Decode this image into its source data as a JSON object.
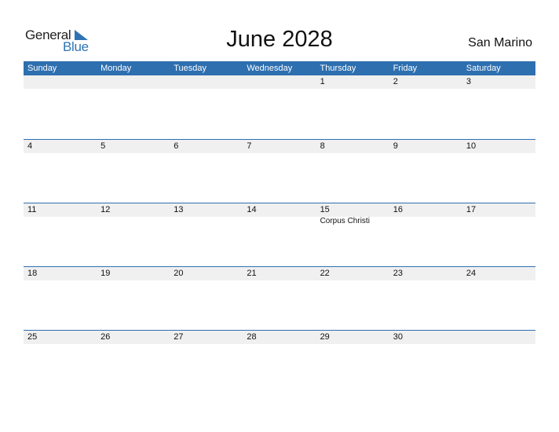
{
  "logo": {
    "text_general": "General",
    "text_blue": "Blue",
    "icon": "triangle-flag-icon"
  },
  "title": "June 2028",
  "country": "San Marino",
  "colors": {
    "accent": "#2e6fb0",
    "strip": "#f0f0f0",
    "logo_blue": "#2e74b5"
  },
  "weekdays": [
    "Sunday",
    "Monday",
    "Tuesday",
    "Wednesday",
    "Thursday",
    "Friday",
    "Saturday"
  ],
  "weeks": [
    [
      {
        "day": ""
      },
      {
        "day": ""
      },
      {
        "day": ""
      },
      {
        "day": ""
      },
      {
        "day": "1"
      },
      {
        "day": "2"
      },
      {
        "day": "3"
      }
    ],
    [
      {
        "day": "4"
      },
      {
        "day": "5"
      },
      {
        "day": "6"
      },
      {
        "day": "7"
      },
      {
        "day": "8"
      },
      {
        "day": "9"
      },
      {
        "day": "10"
      }
    ],
    [
      {
        "day": "11"
      },
      {
        "day": "12"
      },
      {
        "day": "13"
      },
      {
        "day": "14"
      },
      {
        "day": "15",
        "holiday": "Corpus Christi"
      },
      {
        "day": "16"
      },
      {
        "day": "17"
      }
    ],
    [
      {
        "day": "18"
      },
      {
        "day": "19"
      },
      {
        "day": "20"
      },
      {
        "day": "21"
      },
      {
        "day": "22"
      },
      {
        "day": "23"
      },
      {
        "day": "24"
      }
    ],
    [
      {
        "day": "25"
      },
      {
        "day": "26"
      },
      {
        "day": "27"
      },
      {
        "day": "28"
      },
      {
        "day": "29"
      },
      {
        "day": "30"
      },
      {
        "day": ""
      }
    ]
  ]
}
